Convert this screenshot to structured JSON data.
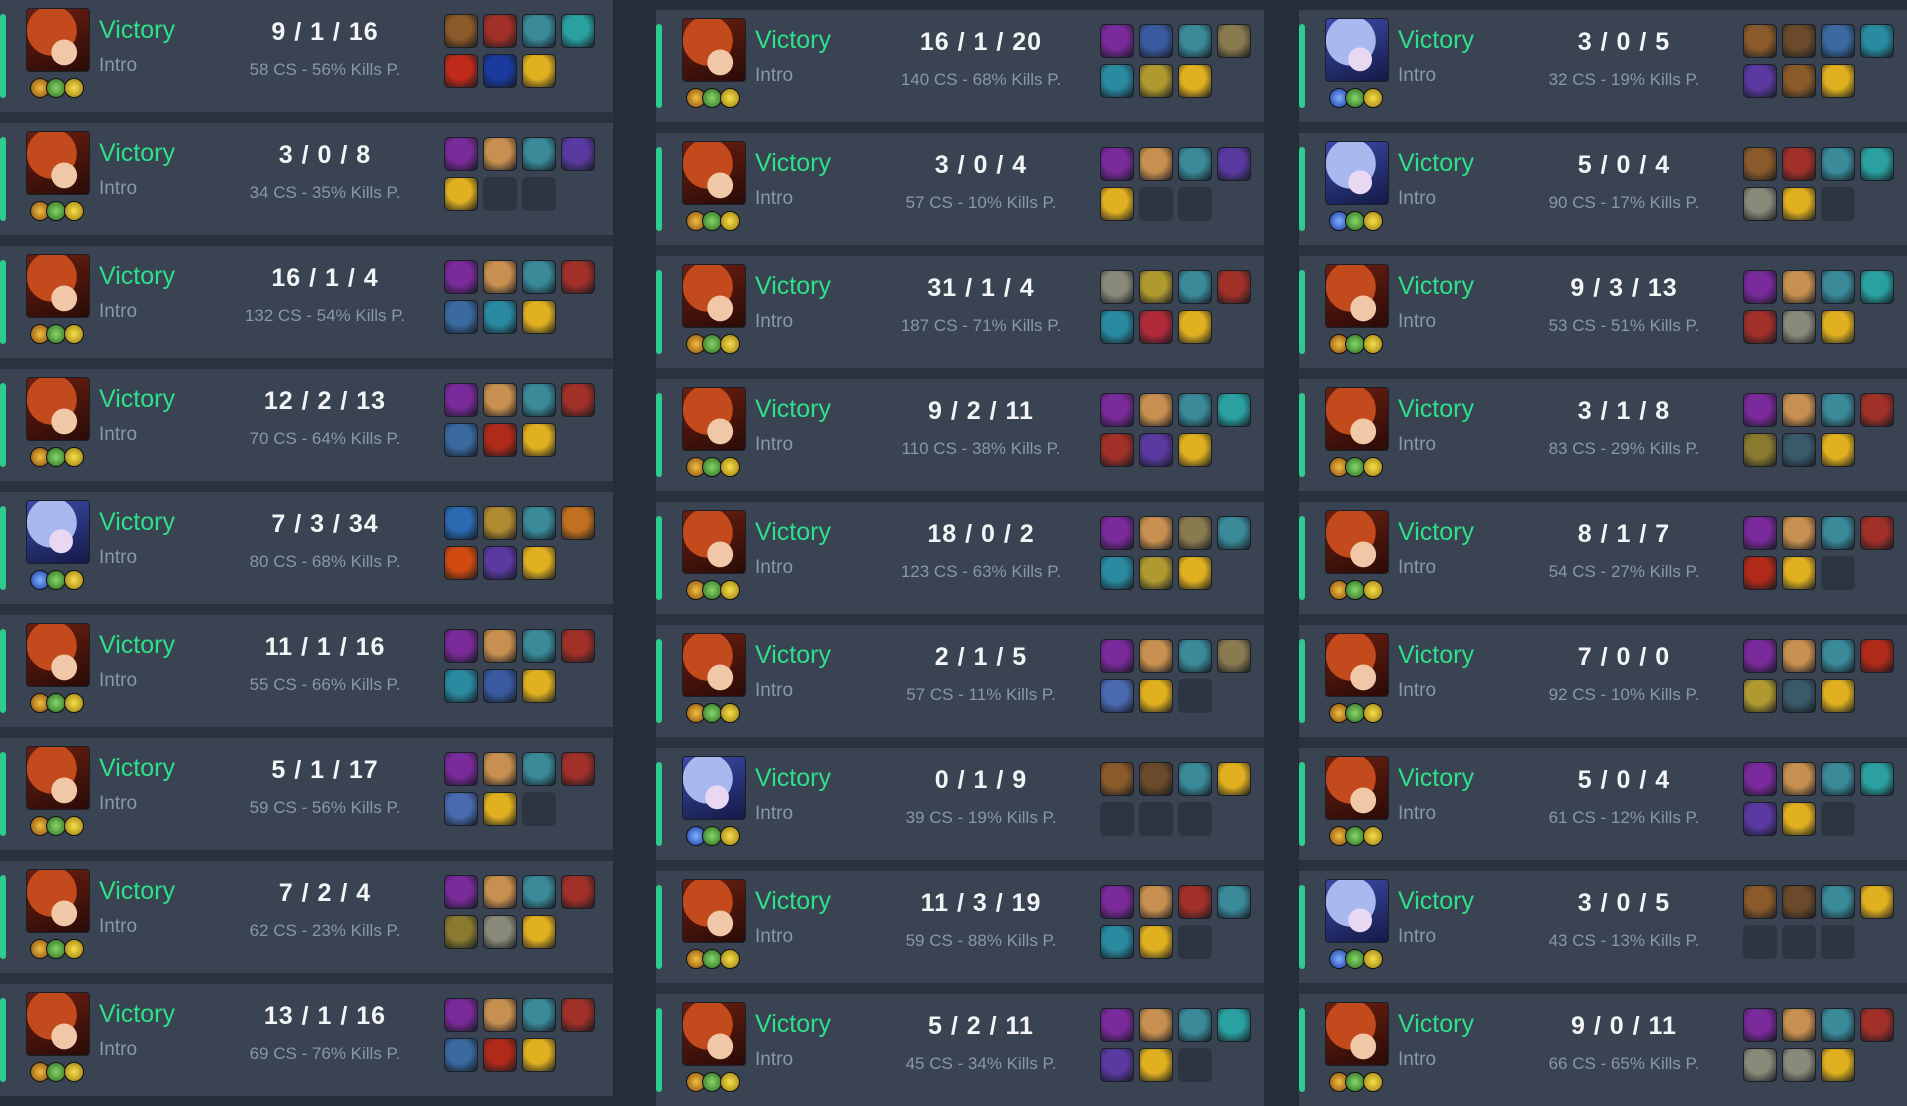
{
  "colors": {
    "victory": "#2ee08a",
    "background": "#252d38",
    "row": "#394352",
    "muted": "#8a97a8"
  },
  "columns": [
    {
      "matches": [
        {
          "champion": "red-hair",
          "result": "Victory",
          "mode": "Intro",
          "kda": "9 / 1 / 16",
          "stats": "58 CS - 56% Kills P.",
          "items": [
            "#8a5a2a",
            "#a03028",
            "#3a8a9a",
            "#2aa0a0",
            "#c02a1a",
            "#1a3aa0",
            "#e0b020"
          ]
        },
        {
          "champion": "red-hair",
          "result": "Victory",
          "mode": "Intro",
          "kda": "3 / 0 / 8",
          "stats": "34 CS - 35% Kills P.",
          "items": [
            "#7a2a9a",
            "#c89050",
            "#3a8a9a",
            "#5a3aa0",
            "#e0b020",
            null,
            null
          ]
        },
        {
          "champion": "red-hair",
          "result": "Victory",
          "mode": "Intro",
          "kda": "16 / 1 / 4",
          "stats": "132 CS - 54% Kills P.",
          "items": [
            "#7a2a9a",
            "#c89050",
            "#3a8a9a",
            "#a03028",
            "#3a6aa0",
            "#2a8aa0",
            "#e0b020"
          ]
        },
        {
          "champion": "red-hair",
          "result": "Victory",
          "mode": "Intro",
          "kda": "12 / 2 / 13",
          "stats": "70 CS - 64% Kills P.",
          "items": [
            "#7a2a9a",
            "#c89050",
            "#3a8a9a",
            "#a03028",
            "#3a6aa0",
            "#b02a1a",
            "#e0b020"
          ]
        },
        {
          "champion": "blue-hair",
          "result": "Victory",
          "mode": "Intro",
          "kda": "7 / 3 / 34",
          "stats": "80 CS - 68% Kills P.",
          "items": [
            "#2a6ab0",
            "#b08a30",
            "#3a8a9a",
            "#c07020",
            "#d04a10",
            "#5a3aa0",
            "#e0b020"
          ]
        },
        {
          "champion": "red-hair",
          "result": "Victory",
          "mode": "Intro",
          "kda": "11 / 1 / 16",
          "stats": "55 CS - 66% Kills P.",
          "items": [
            "#7a2a9a",
            "#c89050",
            "#3a8a9a",
            "#a03028",
            "#2a8aa0",
            "#3a5aa0",
            "#e0b020"
          ]
        },
        {
          "champion": "red-hair",
          "result": "Victory",
          "mode": "Intro",
          "kda": "5 / 1 / 17",
          "stats": "59 CS - 56% Kills P.",
          "items": [
            "#7a2a9a",
            "#c89050",
            "#3a8a9a",
            "#a03028",
            "#4a6ab0",
            "#e0b020",
            null
          ]
        },
        {
          "champion": "red-hair",
          "result": "Victory",
          "mode": "Intro",
          "kda": "7 / 2 / 4",
          "stats": "62 CS - 23% Kills P.",
          "items": [
            "#7a2a9a",
            "#c89050",
            "#3a8a9a",
            "#a03028",
            "#8a7a30",
            "#8a8a7a",
            "#e0b020"
          ]
        },
        {
          "champion": "red-hair",
          "result": "Victory",
          "mode": "Intro",
          "kda": "13 / 1 / 16",
          "stats": "69 CS - 76% Kills P.",
          "items": [
            "#7a2a9a",
            "#c89050",
            "#3a8a9a",
            "#a03028",
            "#3a6aa0",
            "#b02a1a",
            "#e0b020"
          ]
        }
      ]
    },
    {
      "matches": [
        {
          "champion": "red-hair",
          "result": "Victory",
          "mode": "Intro",
          "kda": "16 / 1 / 20",
          "stats": "140 CS - 68% Kills P.",
          "items": [
            "#7a2a9a",
            "#3a5aa0",
            "#3a8a9a",
            "#8a7a50",
            "#2a8aa0",
            "#b09a30",
            "#e0b020"
          ]
        },
        {
          "champion": "red-hair",
          "result": "Victory",
          "mode": "Intro",
          "kda": "3 / 0 / 4",
          "stats": "57 CS - 10% Kills P.",
          "items": [
            "#7a2a9a",
            "#c89050",
            "#3a8a9a",
            "#5a3aa0",
            "#e0b020",
            null,
            null
          ]
        },
        {
          "champion": "red-hair",
          "result": "Victory",
          "mode": "Intro",
          "kda": "31 / 1 / 4",
          "stats": "187 CS - 71% Kills P.",
          "items": [
            "#8a8a7a",
            "#b09a30",
            "#3a8a9a",
            "#a03028",
            "#2a8aa0",
            "#b02a3a",
            "#e0b020"
          ]
        },
        {
          "champion": "red-hair",
          "result": "Victory",
          "mode": "Intro",
          "kda": "9 / 2 / 11",
          "stats": "110 CS - 38% Kills P.",
          "items": [
            "#7a2a9a",
            "#c89050",
            "#3a8a9a",
            "#2aa0a0",
            "#a03028",
            "#5a3aa0",
            "#e0b020"
          ]
        },
        {
          "champion": "red-hair",
          "result": "Victory",
          "mode": "Intro",
          "kda": "18 / 0 / 2",
          "stats": "123 CS - 63% Kills P.",
          "items": [
            "#7a2a9a",
            "#c89050",
            "#8a7a50",
            "#3a8a9a",
            "#2a8aa0",
            "#b09a30",
            "#e0b020"
          ]
        },
        {
          "champion": "red-hair",
          "result": "Victory",
          "mode": "Intro",
          "kda": "2 / 1 / 5",
          "stats": "57 CS - 11% Kills P.",
          "items": [
            "#7a2a9a",
            "#c89050",
            "#3a8a9a",
            "#8a7a50",
            "#4a6ab0",
            "#e0b020",
            null
          ]
        },
        {
          "champion": "blue-hair",
          "result": "Victory",
          "mode": "Intro",
          "kda": "0 / 1 / 9",
          "stats": "39 CS - 19% Kills P.",
          "items": [
            "#8a5a2a",
            "#6a4a2a",
            "#3a8a9a",
            "#e0b020",
            null,
            null,
            null
          ]
        },
        {
          "champion": "red-hair",
          "result": "Victory",
          "mode": "Intro",
          "kda": "11 / 3 / 19",
          "stats": "59 CS - 88% Kills P.",
          "items": [
            "#7a2a9a",
            "#c89050",
            "#a03028",
            "#3a8a9a",
            "#2a8aa0",
            "#e0b020",
            null
          ]
        },
        {
          "champion": "red-hair",
          "result": "Victory",
          "mode": "Intro",
          "kda": "5 / 2 / 11",
          "stats": "45 CS - 34% Kills P.",
          "items": [
            "#7a2a9a",
            "#c89050",
            "#3a8a9a",
            "#2aa0a0",
            "#5a3aa0",
            "#e0b020",
            null
          ]
        }
      ]
    },
    {
      "matches": [
        {
          "champion": "blue-hair",
          "result": "Victory",
          "mode": "Intro",
          "kda": "3 / 0 / 5",
          "stats": "32 CS - 19% Kills P.",
          "items": [
            "#8a5a2a",
            "#6a4a2a",
            "#3a6aa0",
            "#2a8aa0",
            "#5a3aa0",
            "#8a5a2a",
            "#e0b020"
          ]
        },
        {
          "champion": "blue-hair",
          "result": "Victory",
          "mode": "Intro",
          "kda": "5 / 0 / 4",
          "stats": "90 CS - 17% Kills P.",
          "items": [
            "#8a5a2a",
            "#a03028",
            "#3a8a9a",
            "#2aa0a0",
            "#8a8a7a",
            "#e0b020",
            null
          ]
        },
        {
          "champion": "red-hair",
          "result": "Victory",
          "mode": "Intro",
          "kda": "9 / 3 / 13",
          "stats": "53 CS - 51% Kills P.",
          "items": [
            "#7a2a9a",
            "#c89050",
            "#3a8a9a",
            "#2aa0a0",
            "#a03028",
            "#8a8a7a",
            "#e0b020"
          ]
        },
        {
          "champion": "red-hair",
          "result": "Victory",
          "mode": "Intro",
          "kda": "3 / 1 / 8",
          "stats": "83 CS - 29% Kills P.",
          "items": [
            "#7a2a9a",
            "#c89050",
            "#3a8a9a",
            "#a03028",
            "#8a7a30",
            "#3a5a6a",
            "#e0b020"
          ]
        },
        {
          "champion": "red-hair",
          "result": "Victory",
          "mode": "Intro",
          "kda": "8 / 1 / 7",
          "stats": "54 CS - 27% Kills P.",
          "items": [
            "#7a2a9a",
            "#c89050",
            "#3a8a9a",
            "#a03028",
            "#b02a1a",
            "#e0b020",
            null
          ]
        },
        {
          "champion": "red-hair",
          "result": "Victory",
          "mode": "Intro",
          "kda": "7 / 0 / 0",
          "stats": "92 CS - 10% Kills P.",
          "items": [
            "#7a2a9a",
            "#c89050",
            "#3a8a9a",
            "#b02a1a",
            "#b09a30",
            "#3a5a6a",
            "#e0b020"
          ]
        },
        {
          "champion": "red-hair",
          "result": "Victory",
          "mode": "Intro",
          "kda": "5 / 0 / 4",
          "stats": "61 CS - 12% Kills P.",
          "items": [
            "#7a2a9a",
            "#c89050",
            "#3a8a9a",
            "#2aa0a0",
            "#5a3aa0",
            "#e0b020",
            null
          ]
        },
        {
          "champion": "blue-hair",
          "result": "Victory",
          "mode": "Intro",
          "kda": "3 / 0 / 5",
          "stats": "43 CS - 13% Kills P.",
          "items": [
            "#8a5a2a",
            "#6a4a2a",
            "#3a8a9a",
            "#e0b020",
            null,
            null,
            null
          ]
        },
        {
          "champion": "red-hair",
          "result": "Victory",
          "mode": "Intro",
          "kda": "9 / 0 / 11",
          "stats": "66 CS - 65% Kills P.",
          "items": [
            "#7a2a9a",
            "#c89050",
            "#3a8a9a",
            "#a03028",
            "#8a8a7a",
            "#8a8a7a",
            "#e0b020"
          ]
        }
      ]
    }
  ]
}
